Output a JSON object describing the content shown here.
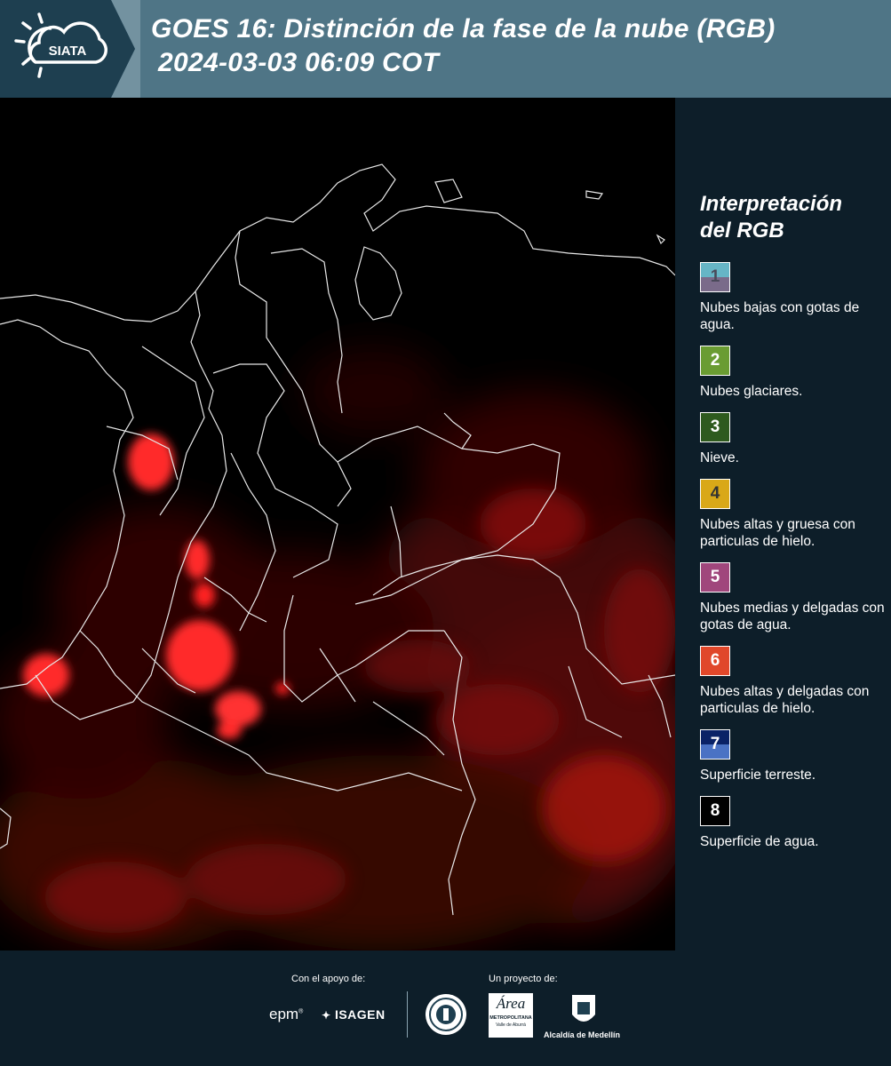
{
  "header": {
    "logo_text": "SIATA",
    "title_line1": "GOES 16: Distinción de la fase de la nube (RGB)",
    "title_line2": "2024-03-03 06:09 COT",
    "background_color": "#4f7586"
  },
  "legend": {
    "title_line1": "Interpretación",
    "title_line2": "del RGB",
    "items": [
      {
        "number": "1",
        "text": "Nubes bajas con gotas de agua.",
        "color_top": "#66b5c6",
        "color_bottom": "#7a6b8a"
      },
      {
        "number": "2",
        "text": "Nubes glaciares.",
        "color": "#6a9c32"
      },
      {
        "number": "3",
        "text": "Nieve.",
        "color": "#2e5a1e"
      },
      {
        "number": "4",
        "text": "Nubes altas y gruesa con particulas de hielo.",
        "color": "#d9a818"
      },
      {
        "number": "5",
        "text": "Nubes medias y delgadas con gotas de agua.",
        "color": "#a0467c"
      },
      {
        "number": "6",
        "text": "Nubes altas y delgadas con particulas de hielo.",
        "color": "#e0472a"
      },
      {
        "number": "7",
        "text": "Superficie terreste.",
        "color_top": "#0a2266",
        "color_bottom": "#4a72c4"
      },
      {
        "number": "8",
        "text": "Superficie de agua.",
        "color": "#000000"
      }
    ]
  },
  "footer": {
    "support_label": "Con el apoyo de:",
    "project_label": "Un proyecto de:",
    "sponsors": [
      "epm",
      "ISAGEN"
    ],
    "partners": [
      "Área Metropolitana",
      "Alcaldía de Medellín"
    ],
    "area_metro_lines": [
      "Área",
      "METROPOLITANA",
      "Valle de Aburrá"
    ],
    "alcaldia_label": "Alcaldía de Medellín"
  },
  "map": {
    "background": "#000000",
    "cloud_color": "#ff1a1a"
  }
}
